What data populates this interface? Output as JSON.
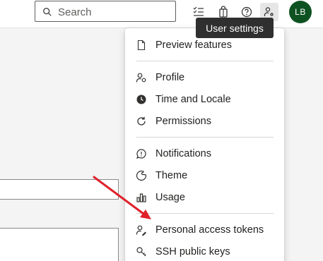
{
  "header": {
    "search_placeholder": "Search",
    "avatar_initials": "LB",
    "tooltip": "User settings",
    "avatar_color": "#0f5222"
  },
  "menu": {
    "items": [
      {
        "label": "Preview features",
        "icon": "document-icon"
      },
      {
        "label": "Profile",
        "icon": "profile-icon"
      },
      {
        "label": "Time and Locale",
        "icon": "clock-globe-icon"
      },
      {
        "label": "Permissions",
        "icon": "refresh-icon"
      },
      {
        "label": "Notifications",
        "icon": "chat-bubble-icon"
      },
      {
        "label": "Theme",
        "icon": "theme-icon"
      },
      {
        "label": "Usage",
        "icon": "bar-chart-icon"
      },
      {
        "label": "Personal access tokens",
        "icon": "person-key-icon"
      },
      {
        "label": "SSH public keys",
        "icon": "key-icon"
      }
    ]
  },
  "annotation_color": "#e0202a"
}
